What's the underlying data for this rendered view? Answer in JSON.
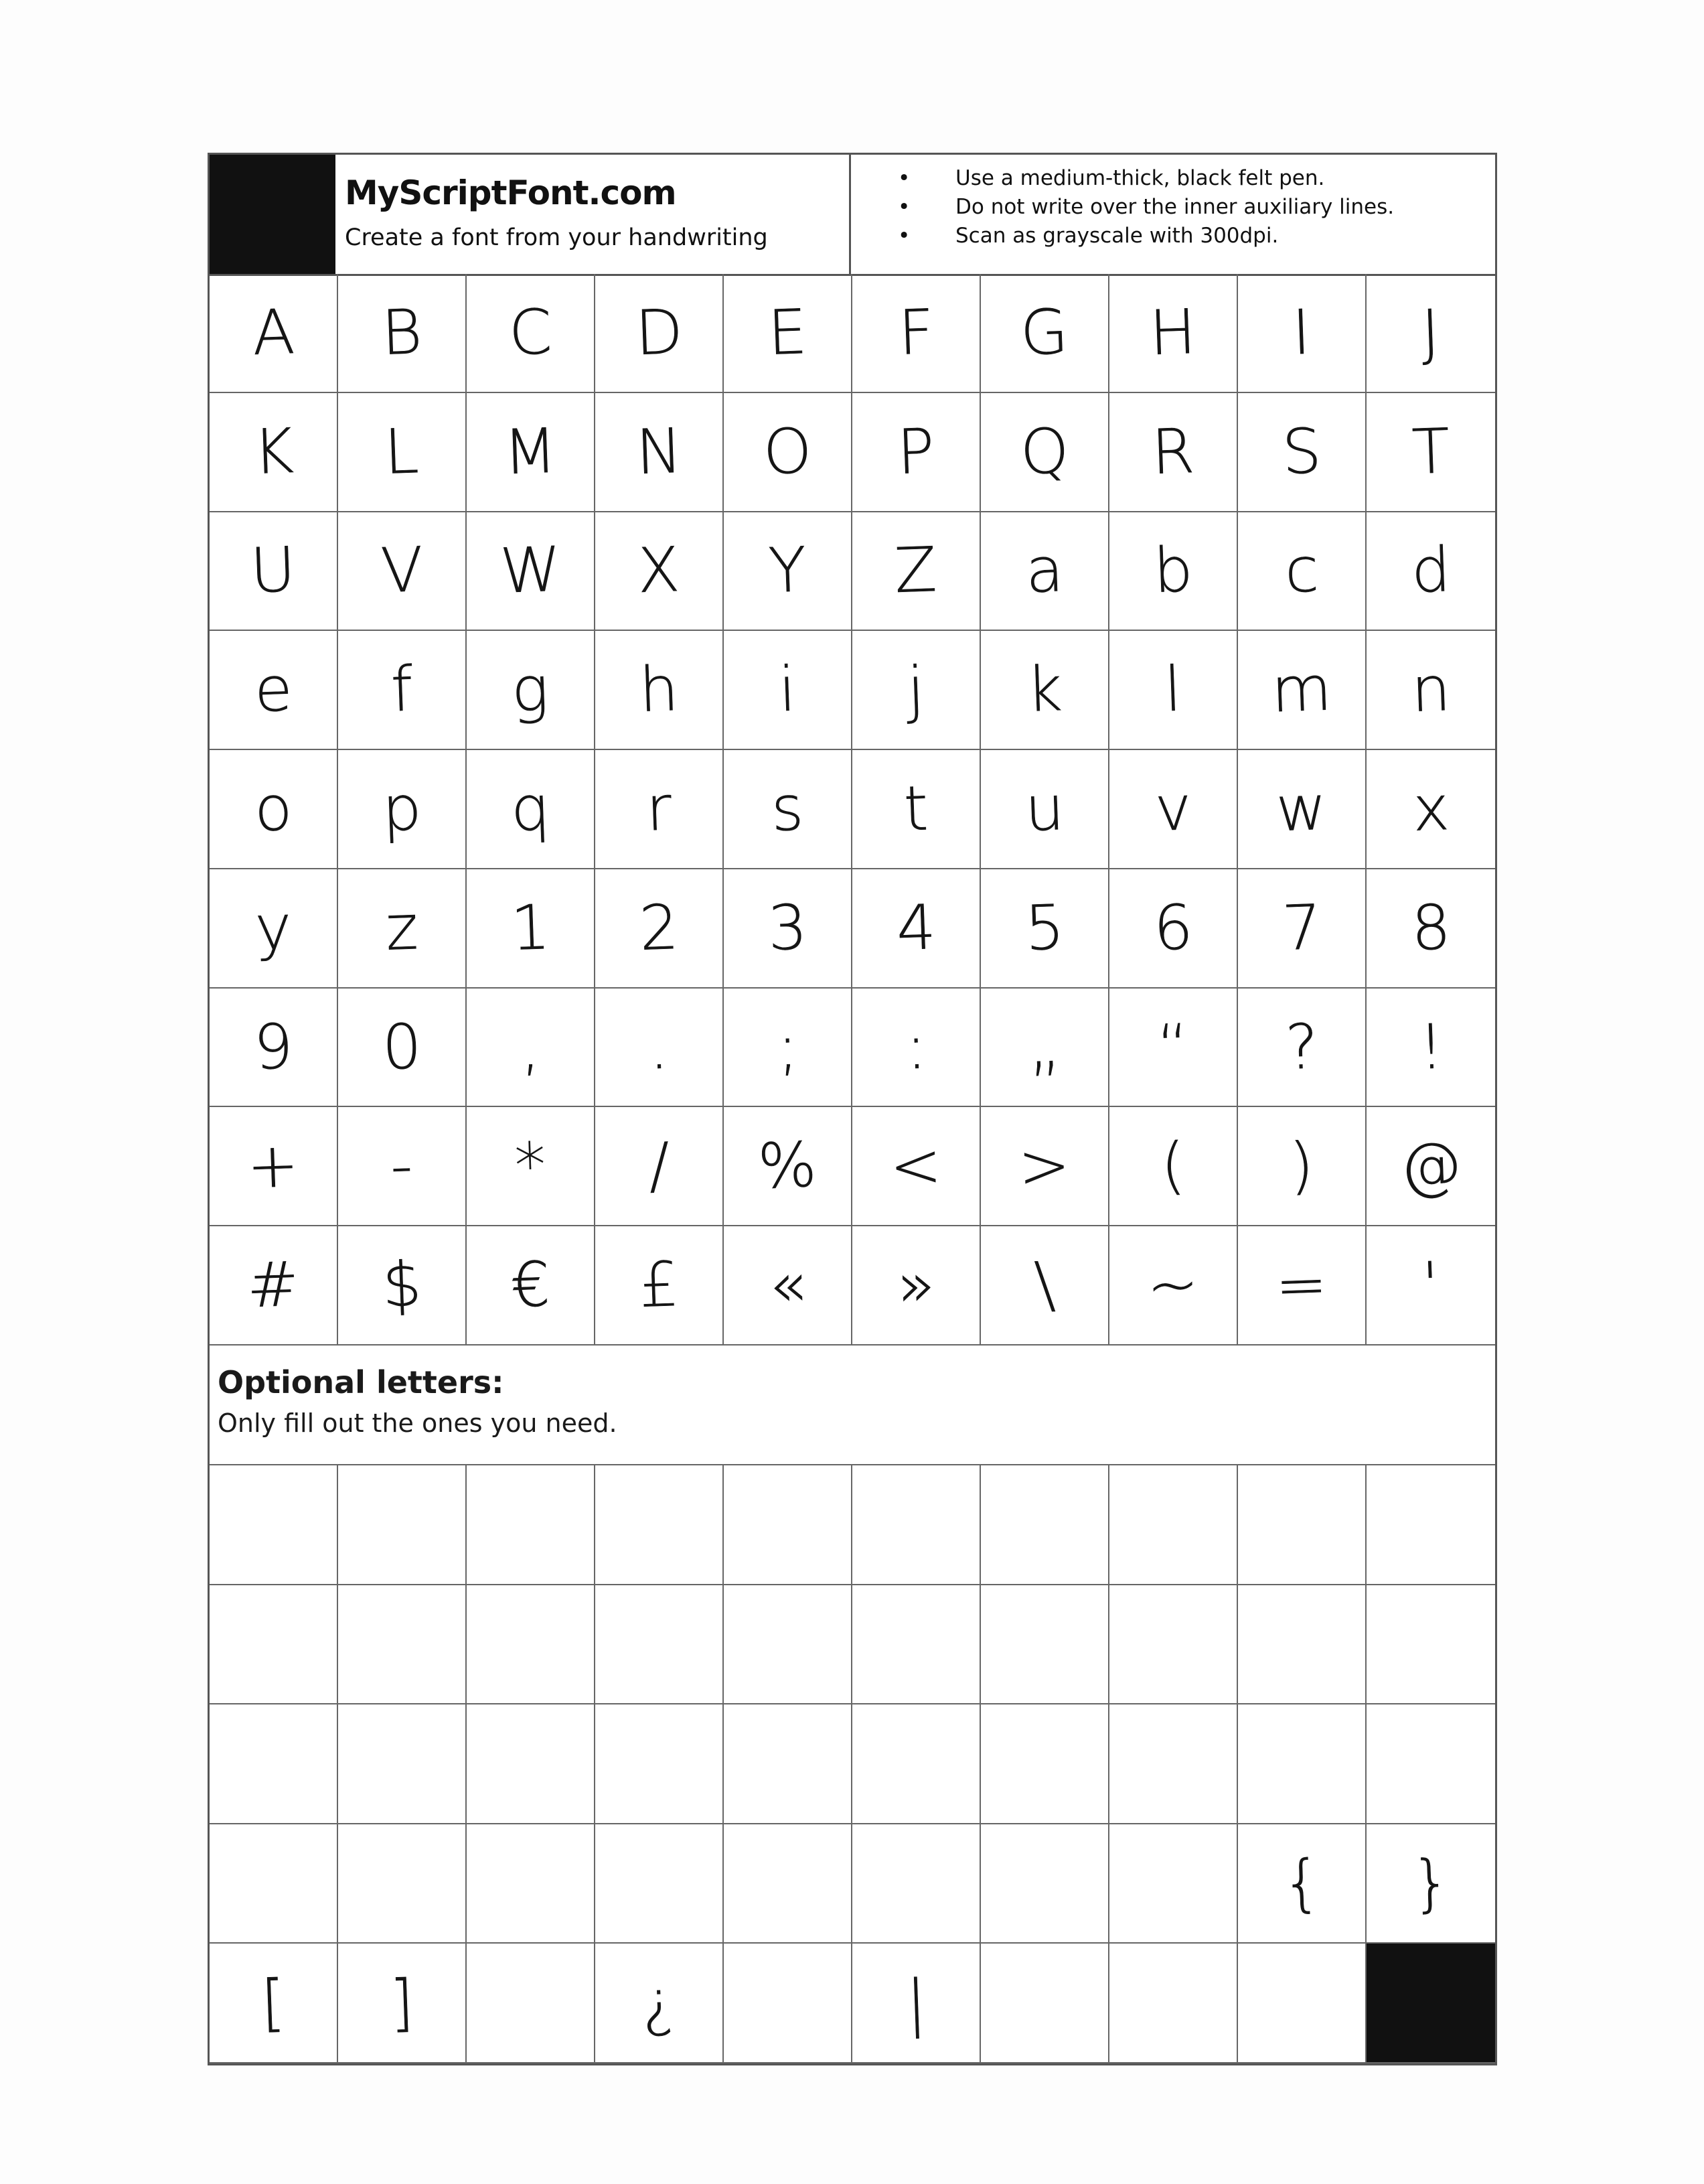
{
  "header": {
    "site": "MyScriptFont.com",
    "tagline": "Create a font from your handwriting",
    "instructions": [
      "Use a medium-thick, black felt pen.",
      "Do not write over the inner auxiliary lines.",
      "Scan as grayscale with 300dpi."
    ]
  },
  "main_grid": [
    [
      "A",
      "B",
      "C",
      "D",
      "E",
      "F",
      "G",
      "H",
      "I",
      "J"
    ],
    [
      "K",
      "L",
      "M",
      "N",
      "O",
      "P",
      "Q",
      "R",
      "S",
      "T"
    ],
    [
      "U",
      "V",
      "W",
      "X",
      "Y",
      "Z",
      "a",
      "b",
      "c",
      "d"
    ],
    [
      "e",
      "f",
      "g",
      "h",
      "i",
      "j",
      "k",
      "l",
      "m",
      "n"
    ],
    [
      "o",
      "p",
      "q",
      "r",
      "s",
      "t",
      "u",
      "v",
      "w",
      "x"
    ],
    [
      "y",
      "z",
      "1",
      "2",
      "3",
      "4",
      "5",
      "6",
      "7",
      "8"
    ],
    [
      "9",
      "0",
      ",",
      ".",
      ";",
      ":",
      "„",
      "“",
      "?",
      "!"
    ],
    [
      "+",
      "-",
      "*",
      "/",
      "%",
      "<",
      ">",
      "(",
      ")",
      "@"
    ],
    [
      "#",
      "$",
      "€",
      "£",
      "«",
      "»",
      "\\",
      "~",
      "=",
      "'"
    ]
  ],
  "optional": {
    "title": "Optional letters:",
    "subtitle": "Only fill out the ones you need."
  },
  "optional_grid": [
    [
      "",
      "",
      "",
      "",
      "",
      "",
      "",
      "",
      "",
      ""
    ],
    [
      "",
      "",
      "",
      "",
      "",
      "",
      "",
      "",
      "",
      ""
    ],
    [
      "",
      "",
      "",
      "",
      "",
      "",
      "",
      "",
      "",
      ""
    ],
    [
      "",
      "",
      "",
      "",
      "",
      "",
      "",
      "",
      "{",
      "}"
    ],
    [
      "[",
      "]",
      "",
      "¿",
      "",
      "|",
      "",
      "",
      "",
      ""
    ]
  ]
}
